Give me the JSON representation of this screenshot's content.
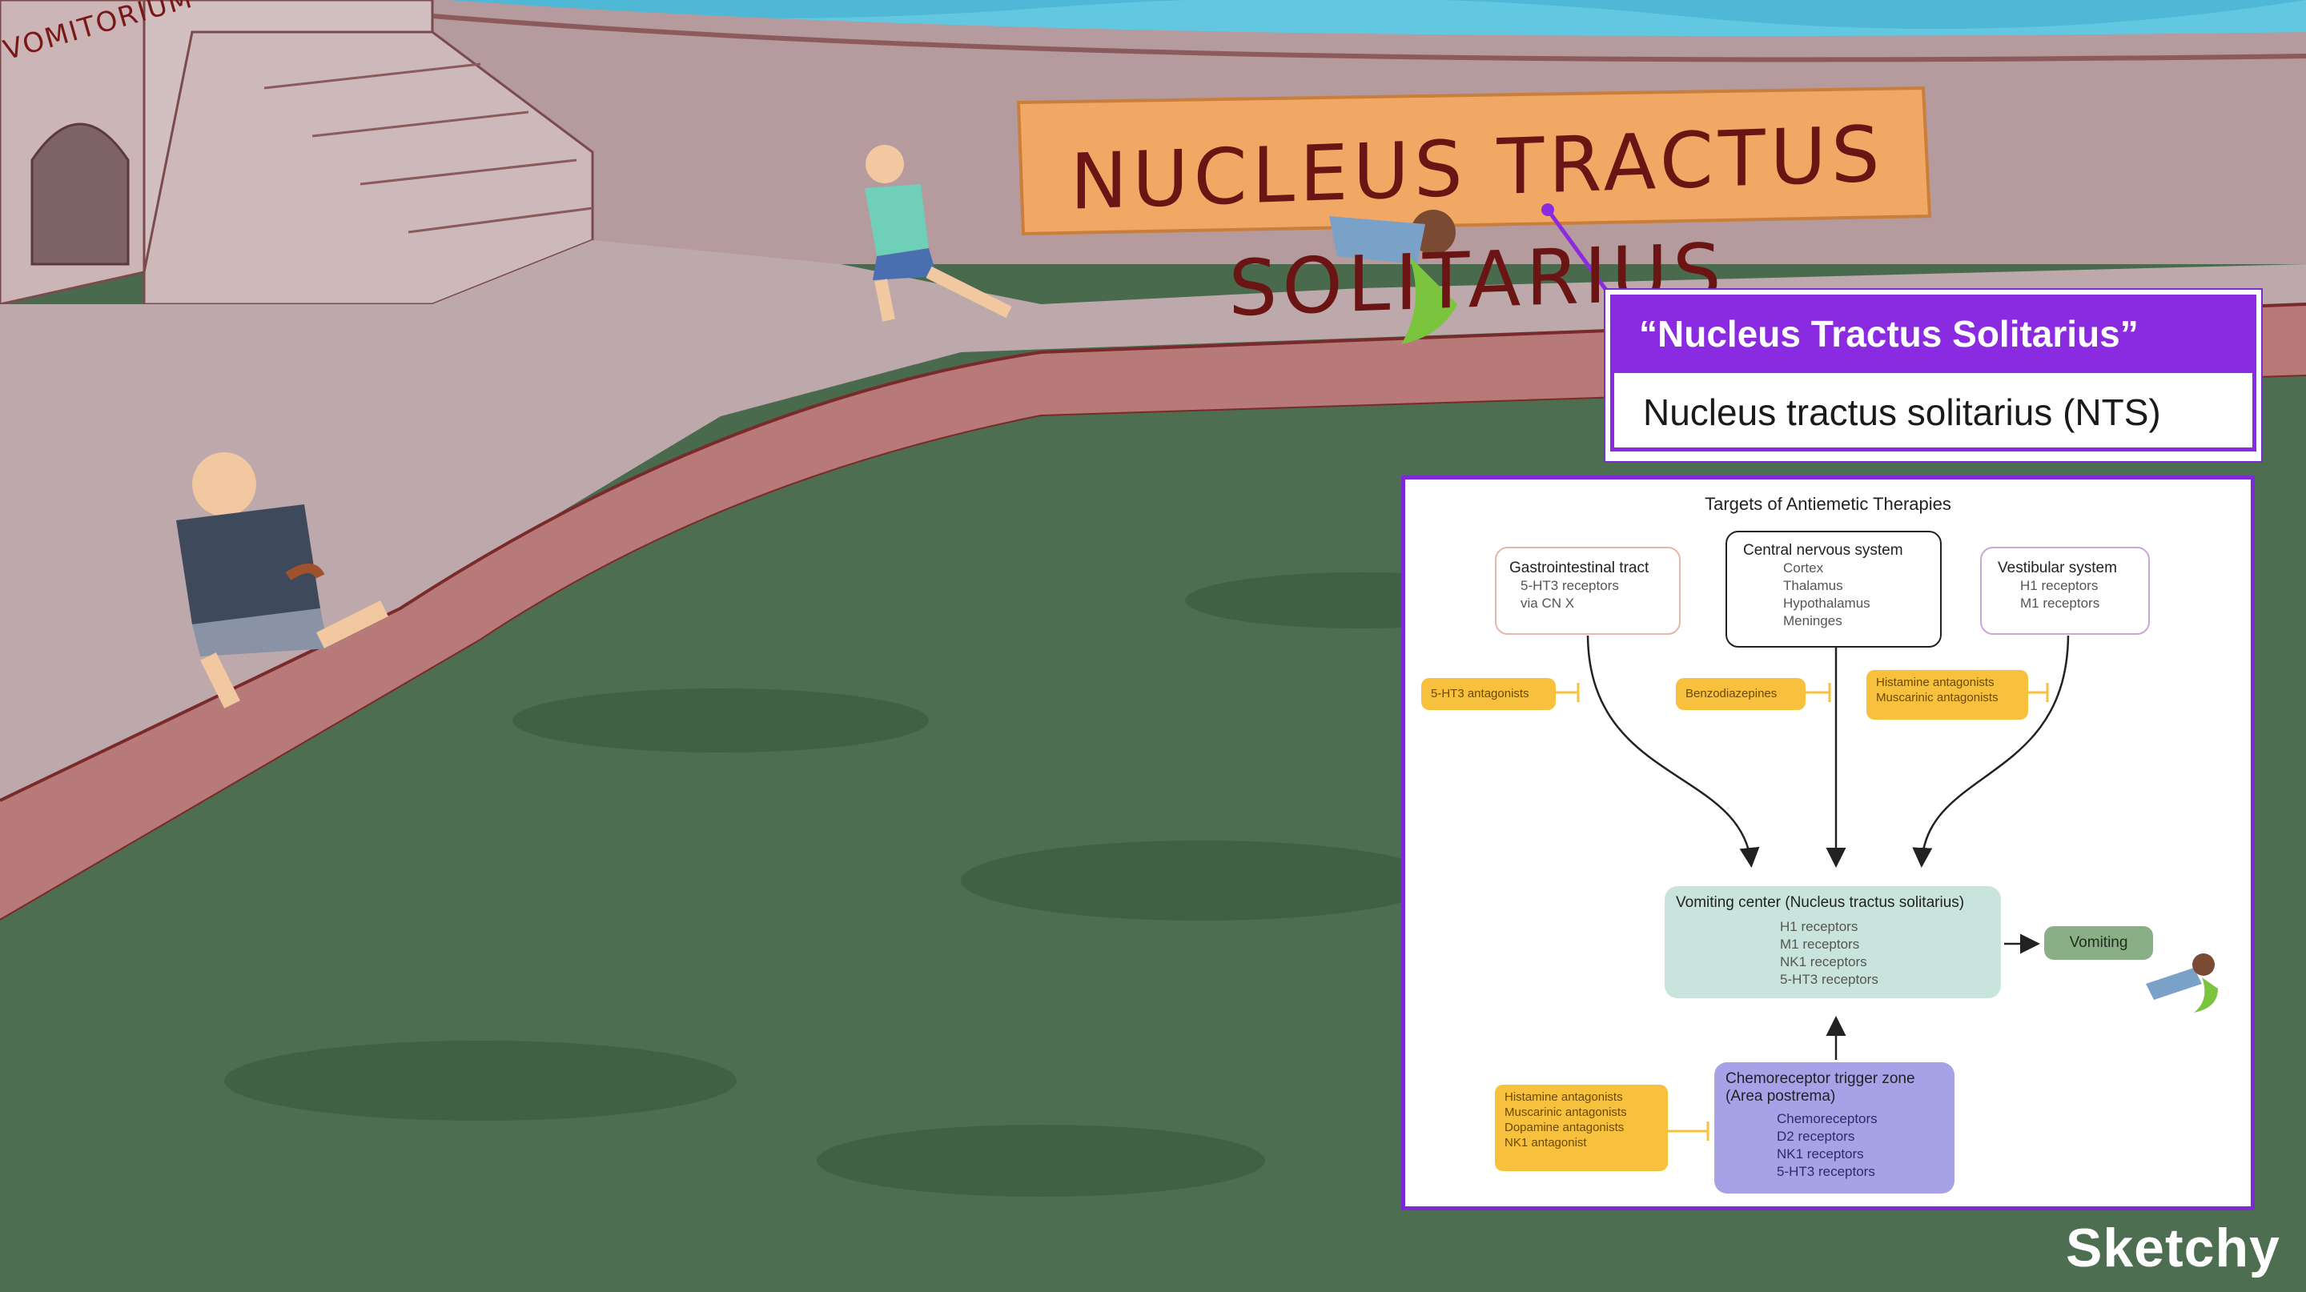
{
  "scene": {
    "sign_text": "NUCLEUS TRACTUS SOLITARIUS",
    "archway_text": "VOMITORIUM"
  },
  "callout": {
    "mnemonic": "“Nucleus Tractus Solitarius”",
    "term": "Nucleus tractus solitarius (NTS)",
    "accent": "#8a2be2"
  },
  "diagram": {
    "title": "Targets of Antiemetic Therapies",
    "gi": {
      "title": "Gastrointestinal tract",
      "lines": [
        "5-HT3 receptors",
        "via CN X"
      ]
    },
    "cns": {
      "title": "Central nervous system",
      "lines": [
        "Cortex",
        "Thalamus",
        "Hypothalamus",
        "Meninges"
      ]
    },
    "vestibular": {
      "title": "Vestibular system",
      "lines": [
        "H1 receptors",
        "M1 receptors"
      ]
    },
    "drug_gi": "5-HT3 antagonists",
    "drug_cns": "Benzodiazepines",
    "drug_vest": [
      "Histamine antagonists",
      "Muscarinic antagonists"
    ],
    "vomiting_center": {
      "title": "Vomiting center (Nucleus tractus solitarius)",
      "lines": [
        "H1 receptors",
        "M1 receptors",
        "NK1 receptors",
        "5-HT3 receptors"
      ]
    },
    "vomiting": "Vomiting",
    "ctz": {
      "title": [
        "Chemoreceptor trigger zone",
        "(Area postrema)"
      ],
      "lines": [
        "Chemoreceptors",
        "D2 receptors",
        "NK1 receptors",
        "5-HT3 receptors"
      ]
    },
    "drug_ctz": [
      "Histamine antagonists",
      "Muscarinic antagonists",
      "Dopamine antagonists",
      "NK1 antagonist"
    ],
    "colors": {
      "drug": "#f7c03d",
      "vomiting_center": "#c9e4dc",
      "ctz": "#a7a2e8",
      "vomiting": "#8aae86"
    }
  },
  "brand": {
    "logo": "Sketchy"
  }
}
